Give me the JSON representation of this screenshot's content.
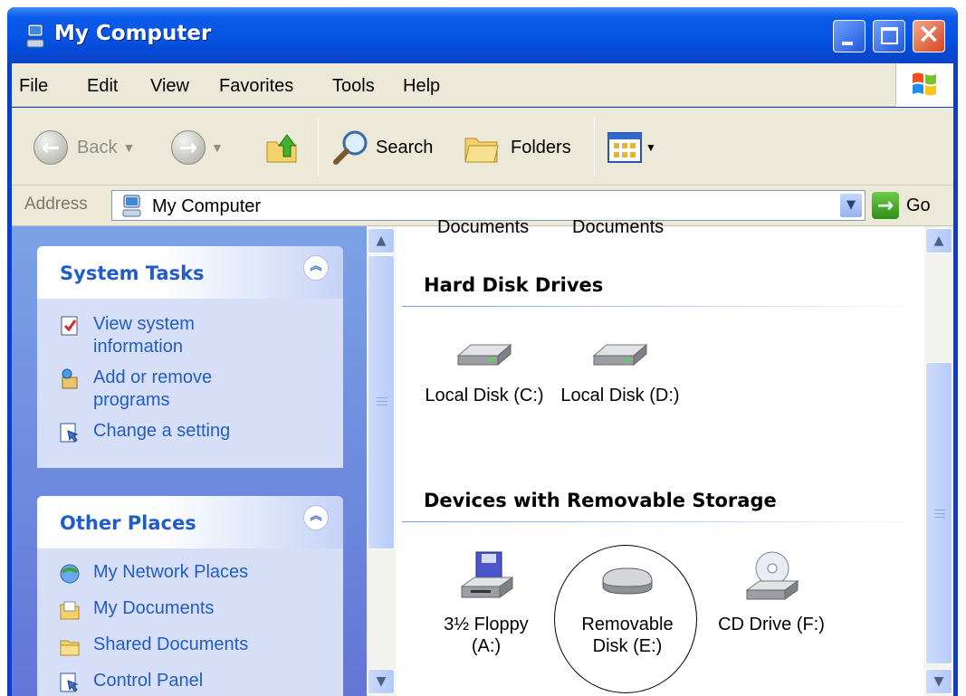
{
  "window": {
    "title": "My Computer"
  },
  "menu": [
    "File",
    "Edit",
    "View",
    "Favorites",
    "Tools",
    "Help"
  ],
  "toolbar": {
    "back": "Back",
    "search": "Search",
    "folders": "Folders"
  },
  "address": {
    "label": "Address",
    "value": "My Computer",
    "go": "Go"
  },
  "left_pane": {
    "system_tasks": {
      "title": "System Tasks",
      "items": [
        {
          "line1": "View system",
          "line2": "information",
          "icon": "system-info-icon"
        },
        {
          "line1": "Add or remove",
          "line2": "programs",
          "icon": "add-remove-programs-icon"
        },
        {
          "line1": "Change a setting",
          "line2": "",
          "icon": "control-panel-setting-icon"
        }
      ]
    },
    "other_places": {
      "title": "Other Places",
      "items": [
        {
          "label": "My Network Places",
          "icon": "network-places-icon"
        },
        {
          "label": "My Documents",
          "icon": "my-documents-icon"
        },
        {
          "label": "Shared Documents",
          "icon": "shared-documents-icon"
        },
        {
          "label": "Control Panel",
          "icon": "control-panel-icon"
        }
      ]
    }
  },
  "content": {
    "cut_off_items": [
      "Documents",
      "Documents"
    ],
    "hard_disk_drives": {
      "title": "Hard Disk Drives",
      "items": [
        {
          "label": "Local Disk (C:)",
          "icon": "hard-disk-icon"
        },
        {
          "label": "Local Disk (D:)",
          "icon": "hard-disk-icon"
        }
      ]
    },
    "removable_storage": {
      "title": "Devices with Removable Storage",
      "items": [
        {
          "line1": "3½ Floppy",
          "line2": "(A:)",
          "icon": "floppy-drive-icon"
        },
        {
          "line1": "Removable",
          "line2": "Disk (E:)",
          "icon": "removable-disk-icon"
        },
        {
          "line1": "CD Drive (F:)",
          "line2": "",
          "icon": "cd-drive-icon"
        }
      ]
    }
  },
  "colors": {
    "title_bar": "#0554e3",
    "task_pane": "#6f8ede",
    "link": "#215dc6",
    "menu_bg": "#ece9d8"
  }
}
